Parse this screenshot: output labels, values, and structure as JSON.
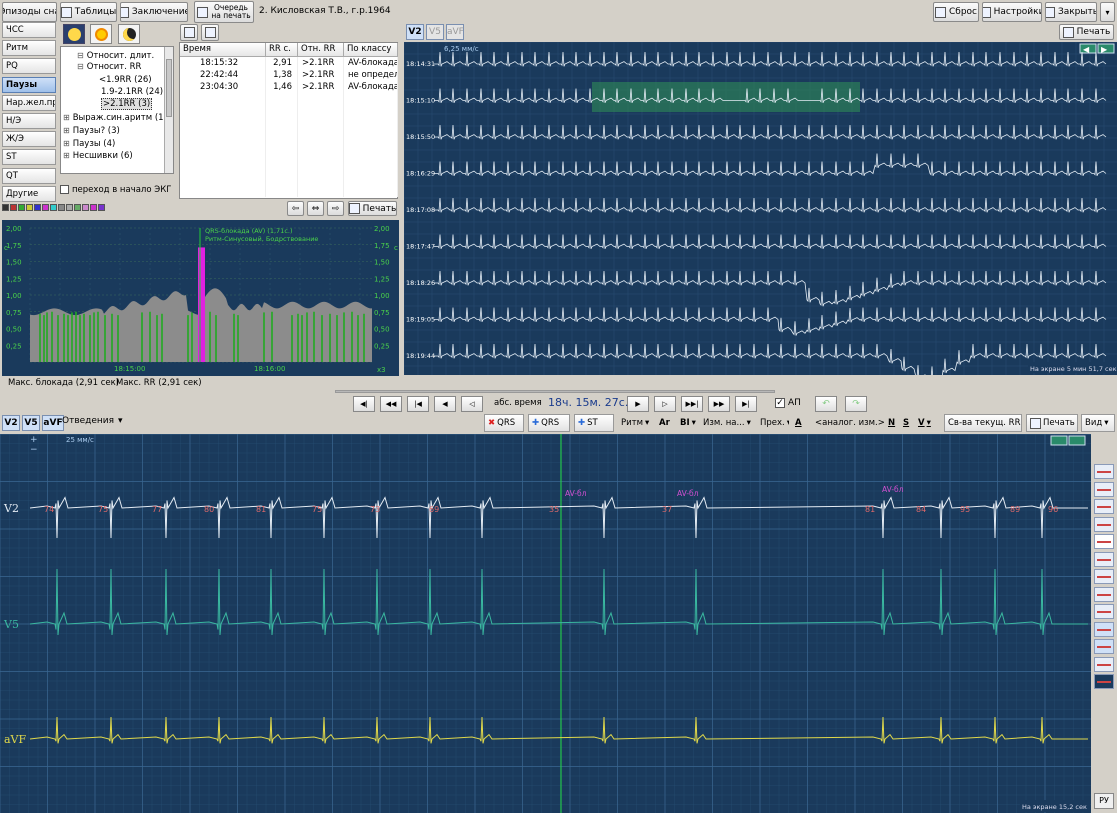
{
  "colors": {
    "ecg_bg": "#1a3a5c",
    "trace": "#dde8f2",
    "green": "#22dd44",
    "magenta": "#cc44cc",
    "v5": "#3ab8a0",
    "avf": "#e0d84a",
    "highlight": "#2e8b57"
  },
  "toolbar": {
    "episodes": "Эпизоды сна",
    "tables": "Таблицы",
    "conclusion": "Заключение",
    "print_queue_1": "Очередь",
    "print_queue_2": "на печать",
    "patient": "2. Кисловская Т.В., г.р.1964",
    "reset": "Сброс",
    "settings": "Настройки",
    "close": "Закрыть"
  },
  "sidebar": {
    "items": [
      "ЧСС",
      "Ритм",
      "PQ",
      "Паузы",
      "Нар.жел.пр.",
      "Н/Э",
      "Ж/Э",
      "ST",
      "QT",
      "Другие"
    ]
  },
  "tree": [
    "Относит. длит.",
    "Относит. RR",
    "<1.9RR (26)",
    "1.9-2.1RR (24)",
    ">2.1RR (3)",
    "Выраж.син.аритм (1)",
    "Паузы? (3)",
    "Паузы (4)",
    "Несшивки (6)"
  ],
  "goto_start": "переход в начало ЭКГ",
  "table": {
    "headers": [
      "Время",
      "RR с.",
      "Отн. RR",
      "По классу"
    ],
    "rows": [
      [
        "18:15:32",
        "2,91",
        ">2.1RR",
        "AV-блокада"
      ],
      [
        "22:42:44",
        "1,38",
        ">2.1RR",
        "не определе"
      ],
      [
        "23:04:30",
        "1,46",
        ">2.1RR",
        "AV-блокада"
      ]
    ],
    "print": "Печать"
  },
  "trend": {
    "annotation_1": "QRS-блокада (AV) (1,71с.)",
    "annotation_2": "Ритм-Синусовый, Бодрствование",
    "y_ticks": [
      "2,00",
      "1,75",
      "1,50",
      "1,25",
      "1,00",
      "0,75",
      "0,50",
      "0,25"
    ],
    "y_unit": "с",
    "x_ticks": [
      "18:15:00",
      "18:16:00"
    ],
    "zoom": "x3",
    "max_block": "Макс. блокада (2,91 сек)",
    "max_rr": "Макс. RR (2,91 сек)"
  },
  "overview": {
    "tabs": [
      "V2",
      "V5",
      "aVF"
    ],
    "print": "Печать",
    "speed": "6,25 мм/с",
    "times": [
      "18:14:31",
      "18:15:10",
      "18:15:50",
      "18:16:29",
      "18:17:08",
      "18:17:47",
      "18:18:26",
      "18:19:05",
      "18:19:44"
    ],
    "footer": "На экране 5 мин 51,7 сек"
  },
  "nav": {
    "abs_label": "абс. время",
    "time": "18ч. 15м. 27с.",
    "ap": "АП"
  },
  "main_toolbar": {
    "leads": [
      "V2",
      "V5",
      "aVF"
    ],
    "leads_menu": "Отведения",
    "qrs_del": "QRS",
    "qrs_add": "QRS",
    "st_add": "ST",
    "rhythm": "Ритм",
    "ar": "Ar",
    "bi": "BI",
    "measure": "Изм. на...",
    "prev": "Прех.",
    "a": "A",
    "analog": "<аналог. изм.>",
    "n": "N",
    "s": "S",
    "v": "V",
    "props": "Св-ва текущ. RR",
    "print": "Печать",
    "view": "Вид"
  },
  "main_strip": {
    "speed": "25 мм/с",
    "lead_labels": [
      "V2",
      "V5",
      "aVF"
    ],
    "hr_values": [
      "74",
      "75",
      "77",
      "80",
      "81",
      "75",
      "73",
      "69",
      "35",
      "37",
      "81",
      "84",
      "95",
      "89",
      "96"
    ],
    "av_labels": [
      "AV-бл",
      "AV-бл",
      "AV-бл"
    ],
    "footer": "На экране 15,2 сек",
    "lang": "РУ"
  }
}
